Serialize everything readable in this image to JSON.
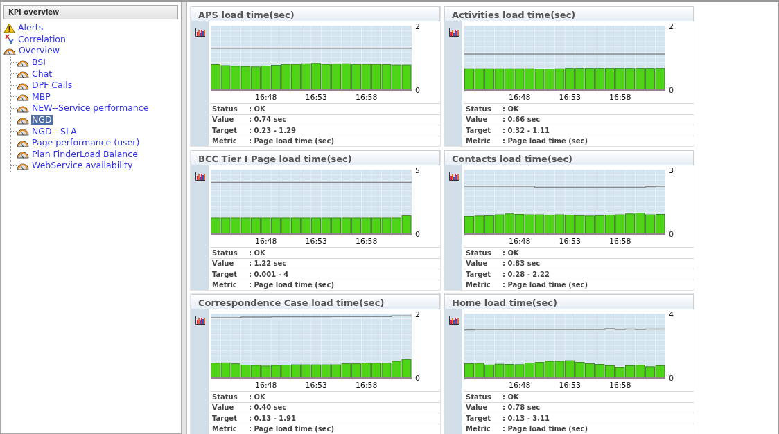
{
  "sidebar": {
    "title": "KPI overview",
    "items": [
      {
        "label": "Alerts",
        "kind": "alert",
        "selected": false
      },
      {
        "label": "Correlation",
        "kind": "correlation",
        "selected": false
      },
      {
        "label": "Overview",
        "kind": "gauge",
        "selected": false,
        "children": [
          {
            "label": "BSI",
            "kind": "gauge",
            "selected": false
          },
          {
            "label": "Chat",
            "kind": "gauge",
            "selected": false
          },
          {
            "label": "DPF Calls",
            "kind": "gauge",
            "selected": false
          },
          {
            "label": "MBP",
            "kind": "gauge",
            "selected": false
          },
          {
            "label": "NEW--Service performance",
            "kind": "gauge",
            "selected": false
          },
          {
            "label": "NGD",
            "kind": "gauge",
            "selected": true
          },
          {
            "label": "NGD - SLA",
            "kind": "gauge",
            "selected": false
          },
          {
            "label": "Page performance (user)",
            "kind": "gauge",
            "selected": false
          },
          {
            "label": "Plan FinderLoad Balance",
            "kind": "gauge",
            "selected": false
          },
          {
            "label": "WebService availability",
            "kind": "gauge",
            "selected": false
          }
        ]
      }
    ]
  },
  "panels": [
    {
      "title": "APS load time(sec)",
      "time_labels": [
        "16:48",
        "16:53",
        "16:58"
      ],
      "chart_data": {
        "type": "bar",
        "ylim": [
          0,
          2
        ],
        "yticks": [
          0,
          2
        ],
        "series": [
          {
            "color": "#4fd317",
            "values": [
              0.77,
              0.74,
              0.72,
              0.71,
              0.7,
              0.73,
              0.75,
              0.78,
              0.78,
              0.8,
              0.81,
              0.78,
              0.79,
              0.8,
              0.78,
              0.78,
              0.78,
              0.77,
              0.76,
              0.76
            ]
          },
          {
            "type": "line",
            "color": "#888888",
            "values": [
              1.29,
              1.29,
              1.29,
              1.29,
              1.29,
              1.29,
              1.29,
              1.29,
              1.29,
              1.29,
              1.29,
              1.29,
              1.29,
              1.29,
              1.29,
              1.29,
              1.29,
              1.29,
              1.29,
              1.29
            ]
          }
        ]
      },
      "details": [
        {
          "label": "Status",
          "value": ": OK"
        },
        {
          "label": "Value",
          "value": ": 0.74 sec"
        },
        {
          "label": "Target",
          "value": ": 0.23 - 1.29"
        },
        {
          "label": "Metric",
          "value": ": Page load time (sec)"
        }
      ]
    },
    {
      "title": "Activities load time(sec)",
      "time_labels": [
        "16:48",
        "16:53",
        "16:58"
      ],
      "chart_data": {
        "type": "bar",
        "ylim": [
          0,
          2
        ],
        "yticks": [
          0,
          2
        ],
        "series": [
          {
            "color": "#4fd317",
            "values": [
              0.65,
              0.65,
              0.65,
              0.65,
              0.65,
              0.65,
              0.65,
              0.64,
              0.64,
              0.65,
              0.66,
              0.66,
              0.66,
              0.66,
              0.66,
              0.66,
              0.66,
              0.66,
              0.66,
              0.66
            ]
          },
          {
            "type": "line",
            "color": "#888888",
            "values": [
              1.11,
              1.11,
              1.11,
              1.11,
              1.11,
              1.11,
              1.11,
              1.11,
              1.11,
              1.11,
              1.11,
              1.11,
              1.11,
              1.11,
              1.11,
              1.11,
              1.11,
              1.11,
              1.11,
              1.11
            ]
          }
        ]
      },
      "details": [
        {
          "label": "Status",
          "value": ": OK"
        },
        {
          "label": "Value",
          "value": ": 0.66 sec"
        },
        {
          "label": "Target",
          "value": ": 0.32 - 1.11"
        },
        {
          "label": "Metric",
          "value": ": Page load time (sec)"
        }
      ]
    },
    {
      "title": "BCC Tier I Page load time(sec)",
      "time_labels": [
        "16:48",
        "16:53",
        "16:58"
      ],
      "chart_data": {
        "type": "bar",
        "ylim": [
          0,
          5
        ],
        "yticks": [
          0,
          5
        ],
        "series": [
          {
            "color": "#4fd317",
            "values": [
              1.2,
              1.2,
              1.2,
              1.2,
              1.2,
              1.2,
              1.2,
              1.2,
              1.2,
              1.2,
              1.2,
              1.2,
              1.2,
              1.2,
              1.2,
              1.2,
              1.2,
              1.2,
              1.2,
              1.38
            ]
          },
          {
            "type": "line",
            "color": "#888888",
            "values": [
              4,
              4,
              4,
              4,
              4,
              4,
              4,
              4,
              4,
              4,
              4,
              4,
              4,
              4,
              4,
              4,
              4,
              4,
              4,
              4
            ]
          }
        ]
      },
      "details": [
        {
          "label": "Status",
          "value": ": OK"
        },
        {
          "label": "Value",
          "value": ": 1.22 sec"
        },
        {
          "label": "Target",
          "value": ": 0.001 - 4"
        },
        {
          "label": "Metric",
          "value": ": Page load time (sec)"
        }
      ]
    },
    {
      "title": "Contacts load time(sec)",
      "time_labels": [
        "16:48",
        "16:53",
        "16:58"
      ],
      "chart_data": {
        "type": "bar",
        "ylim": [
          0,
          3
        ],
        "yticks": [
          0,
          3
        ],
        "series": [
          {
            "color": "#4fd317",
            "values": [
              0.8,
              0.82,
              0.83,
              0.88,
              0.92,
              0.9,
              0.88,
              0.88,
              0.86,
              0.88,
              0.86,
              0.84,
              0.82,
              0.84,
              0.86,
              0.88,
              0.92,
              0.96,
              0.88,
              0.9
            ]
          },
          {
            "type": "line",
            "color": "#888888",
            "values": [
              2.22,
              2.22,
              2.22,
              2.22,
              2.22,
              2.22,
              2.22,
              2.17,
              2.17,
              2.17,
              2.17,
              2.17,
              2.17,
              2.17,
              2.17,
              2.17,
              2.17,
              2.17,
              2.2,
              2.22
            ]
          }
        ]
      },
      "details": [
        {
          "label": "Status",
          "value": ": OK"
        },
        {
          "label": "Value",
          "value": ": 0.83 sec"
        },
        {
          "label": "Target",
          "value": ": 0.28 - 2.22"
        },
        {
          "label": "Metric",
          "value": ": Page load time (sec)"
        }
      ]
    },
    {
      "title": "Correspondence Case load time(sec)",
      "time_labels": [
        "16:48",
        "16:53",
        "16:58"
      ],
      "chart_data": {
        "type": "bar",
        "ylim": [
          0,
          2
        ],
        "yticks": [
          0,
          2
        ],
        "series": [
          {
            "color": "#4fd317",
            "values": [
              0.44,
              0.45,
              0.42,
              0.38,
              0.37,
              0.35,
              0.37,
              0.38,
              0.39,
              0.39,
              0.39,
              0.39,
              0.39,
              0.42,
              0.42,
              0.44,
              0.44,
              0.44,
              0.5,
              0.56
            ]
          },
          {
            "type": "line",
            "color": "#888888",
            "values": [
              1.87,
              1.87,
              1.87,
              1.89,
              1.89,
              1.89,
              1.9,
              1.9,
              1.9,
              1.9,
              1.9,
              1.9,
              1.91,
              1.91,
              1.91,
              1.91,
              1.91,
              1.91,
              1.93,
              1.93
            ]
          }
        ]
      },
      "details": [
        {
          "label": "Status",
          "value": ": OK"
        },
        {
          "label": "Value",
          "value": ": 0.40 sec"
        },
        {
          "label": "Target",
          "value": ": 0.13 - 1.91"
        },
        {
          "label": "Metric",
          "value": ": Page load time (sec)"
        }
      ]
    },
    {
      "title": "Home load time(sec)",
      "time_labels": [
        "16:48",
        "16:53",
        "16:58"
      ],
      "chart_data": {
        "type": "bar",
        "ylim": [
          0,
          4
        ],
        "yticks": [
          0,
          4
        ],
        "series": [
          {
            "color": "#4fd317",
            "values": [
              0.85,
              0.87,
              0.77,
              0.82,
              0.8,
              0.79,
              0.89,
              0.93,
              1.0,
              1.0,
              1.04,
              0.94,
              0.85,
              0.8,
              0.72,
              0.63,
              0.72,
              0.75,
              0.66,
              0.72
            ]
          },
          {
            "type": "line",
            "color": "#888888",
            "values": [
              2.98,
              3.0,
              3.0,
              3.0,
              3.0,
              3.0,
              3.0,
              3.0,
              3.0,
              3.0,
              3.0,
              3.0,
              3.0,
              3.0,
              3.04,
              3.0,
              3.02,
              3.0,
              3.02,
              3.02
            ]
          }
        ]
      },
      "details": [
        {
          "label": "Status",
          "value": ": OK"
        },
        {
          "label": "Value",
          "value": ": 0.78 sec"
        },
        {
          "label": "Target",
          "value": ": 0.13 - 3.11"
        },
        {
          "label": "Metric",
          "value": ": Page load time (sec)"
        }
      ]
    }
  ]
}
